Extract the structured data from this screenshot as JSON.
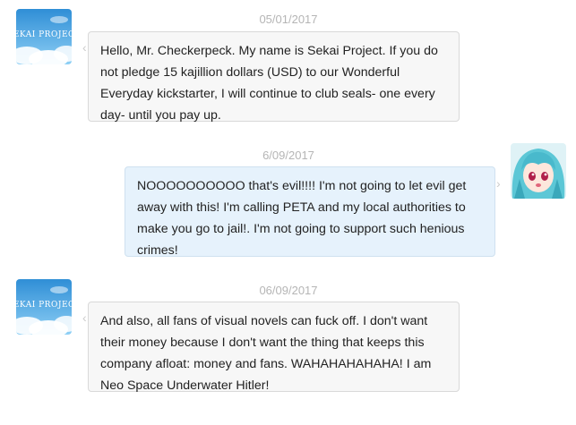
{
  "messages": [
    {
      "date": "05/01/2017",
      "sender": "Sekai Project",
      "avatar_icon": "sekai-project-avatar-icon",
      "avatar_logo_text": "SEKAI PROJECT",
      "text": "Hello, Mr. Checkerpeck. My name is Sekai Project. If you do not pledge 15 kajillion dollars (USD) to our Wonderful Everyday kickstarter, I will continue to club seals- one every day- until you pay up."
    },
    {
      "date": "6/09/2017",
      "sender": "me",
      "avatar_icon": "anime-girl-avatar-icon",
      "text": "NOOOOOOOOOO that's evil!!!! I'm not going to let evil get away with this! I'm calling PETA and my local authorities to make you go to jail!. I'm not going to support such henious crimes!"
    },
    {
      "date": "06/09/2017",
      "sender": "Sekai Project",
      "avatar_icon": "sekai-project-avatar-icon",
      "avatar_logo_text": "SEKAI PROJECT",
      "text": "And also, all fans of visual novels can fuck off. I don't want their money because I don't want the thing that keeps this company afloat: money and fans. WAHAHAHAHAHA! I am Neo Space Underwater Hitler!"
    }
  ],
  "colors": {
    "incoming_bubble": "#f7f7f7",
    "outgoing_bubble": "#e6f2fc",
    "date_text": "#b5b5b5",
    "avatar_sky": "#4aa3dd"
  }
}
